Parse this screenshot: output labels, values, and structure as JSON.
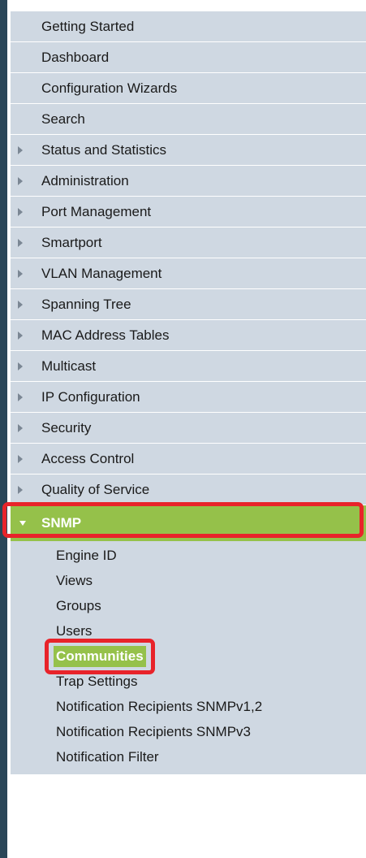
{
  "nav": {
    "items": [
      {
        "label": "Getting Started",
        "has_arrow": false
      },
      {
        "label": "Dashboard",
        "has_arrow": false
      },
      {
        "label": "Configuration Wizards",
        "has_arrow": false
      },
      {
        "label": "Search",
        "has_arrow": false
      },
      {
        "label": "Status and Statistics",
        "has_arrow": true
      },
      {
        "label": "Administration",
        "has_arrow": true
      },
      {
        "label": "Port Management",
        "has_arrow": true
      },
      {
        "label": "Smartport",
        "has_arrow": true
      },
      {
        "label": "VLAN Management",
        "has_arrow": true
      },
      {
        "label": "Spanning Tree",
        "has_arrow": true
      },
      {
        "label": "MAC Address Tables",
        "has_arrow": true
      },
      {
        "label": "Multicast",
        "has_arrow": true
      },
      {
        "label": "IP Configuration",
        "has_arrow": true
      },
      {
        "label": "Security",
        "has_arrow": true
      },
      {
        "label": "Access Control",
        "has_arrow": true
      },
      {
        "label": "Quality of Service",
        "has_arrow": true
      }
    ],
    "expanded": {
      "label": "SNMP",
      "sub_items": [
        {
          "label": "Engine ID",
          "selected": false
        },
        {
          "label": "Views",
          "selected": false
        },
        {
          "label": "Groups",
          "selected": false
        },
        {
          "label": "Users",
          "selected": false
        },
        {
          "label": "Communities",
          "selected": true
        },
        {
          "label": "Trap Settings",
          "selected": false
        },
        {
          "label": "Notification Recipients SNMPv1,2",
          "selected": false
        },
        {
          "label": "Notification Recipients SNMPv3",
          "selected": false
        },
        {
          "label": "Notification Filter",
          "selected": false
        }
      ]
    }
  },
  "colors": {
    "item_bg": "#cfd8e2",
    "accent_green": "#95c14a",
    "highlight_red": "#e8232a",
    "left_bar": "#2a4658"
  },
  "icons": {
    "collapsed_arrow": "triangle-right-icon",
    "expanded_arrow": "triangle-down-icon"
  }
}
